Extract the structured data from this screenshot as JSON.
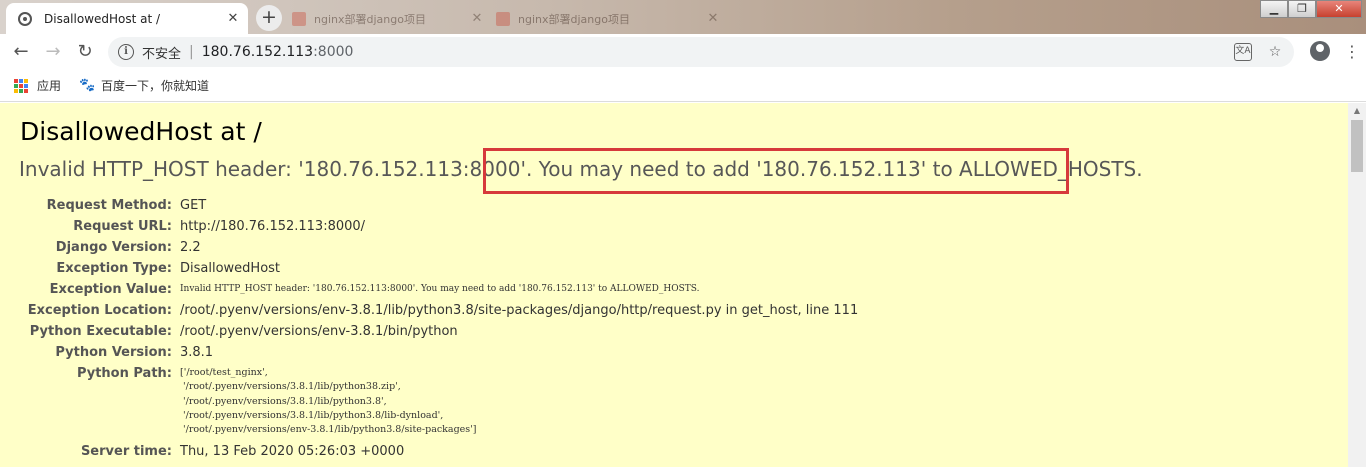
{
  "browser": {
    "active_tab_title": "DisallowedHost at /",
    "background_tabs": [
      "nginx部署django项目",
      "nginx部署django项目"
    ],
    "new_tab_label": "+",
    "security_label": "不安全",
    "url_host": "180.76.152.113",
    "url_port": ":8000",
    "bookmarks": [
      {
        "label": "应用",
        "icon": "apps-grid-icon"
      },
      {
        "label": "百度一下，你就知道",
        "icon": "baidu-paw-icon"
      }
    ]
  },
  "error": {
    "heading": "DisallowedHost at /",
    "summary_part1": "Invalid HTTP_HOST header: '180.76.152.113:8000'.",
    "summary_part2": " You may need to add '180.76.152.113' to ALLOWED_HOSTS.",
    "rows": [
      {
        "label": "Request Method:",
        "value": "GET"
      },
      {
        "label": "Request URL:",
        "value": "http://180.76.152.113:8000/"
      },
      {
        "label": "Django Version:",
        "value": "2.2"
      },
      {
        "label": "Exception Type:",
        "value": "DisallowedHost"
      },
      {
        "label": "Exception Value:",
        "value": "Invalid HTTP_HOST header: '180.76.152.113:8000'. You may need to add '180.76.152.113' to ALLOWED_HOSTS."
      },
      {
        "label": "Exception Location:",
        "value": "/root/.pyenv/versions/env-3.8.1/lib/python3.8/site-packages/django/http/request.py in get_host, line 111"
      },
      {
        "label": "Python Executable:",
        "value": "/root/.pyenv/versions/env-3.8.1/bin/python"
      },
      {
        "label": "Python Version:",
        "value": "3.8.1"
      },
      {
        "label": "Python Path:",
        "value": ""
      },
      {
        "label": "Server time:",
        "value": "Thu, 13 Feb 2020 05:26:03 +0000"
      }
    ],
    "python_path": [
      "['/root/test_nginx',",
      " '/root/.pyenv/versions/3.8.1/lib/python38.zip',",
      " '/root/.pyenv/versions/3.8.1/lib/python3.8',",
      " '/root/.pyenv/versions/3.8.1/lib/python3.8/lib-dynload',",
      " '/root/.pyenv/versions/env-3.8.1/lib/python3.8/site-packages']"
    ]
  },
  "colors": {
    "page_background": "#ffffc8",
    "highlight_border": "#d6393b"
  }
}
